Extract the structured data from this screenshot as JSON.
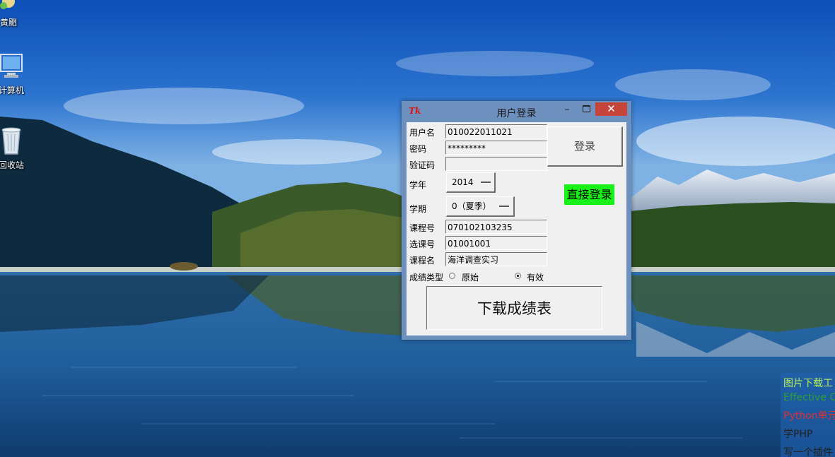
{
  "desktop": {
    "icons": [
      {
        "label": "黄颲",
        "icon": "user-folder-icon"
      },
      {
        "label": "计算机",
        "icon": "computer-icon"
      },
      {
        "label": "回收站",
        "icon": "recycle-bin-icon"
      }
    ]
  },
  "window": {
    "logo": "Tk",
    "title": "用户登录",
    "min_symbol": "–",
    "close_symbol": "✕"
  },
  "form": {
    "username_label": "用户名",
    "username_value": "010022011021",
    "password_label": "密码",
    "password_value": "*********",
    "captcha_label": "验证码",
    "captcha_value": "",
    "login_button": "登录",
    "year_label": "学年",
    "year_value": "2014",
    "term_label": "学期",
    "term_value": "0（夏季）",
    "direct_login_button": "直接登录",
    "course_no_label": "课程号",
    "course_no_value": "070102103235",
    "selection_no_label": "选课号",
    "selection_no_value": "01001001",
    "course_name_label": "课程名",
    "course_name_value": "海洋调查实习",
    "score_type_label": "成绩类型",
    "score_type_options": [
      "原始",
      "有效"
    ],
    "score_type_selected": "有效",
    "download_button": "下载成绩表"
  },
  "side_panel": {
    "items": [
      {
        "text": "图片下载工",
        "color": "#b8f055"
      },
      {
        "text": "Effective C",
        "color": "#2b9e3b"
      },
      {
        "text": "Python单元",
        "color": "#e03030"
      },
      {
        "text": "学PHP",
        "color": "#222222"
      },
      {
        "text": "写一个插件",
        "color": "#222222"
      }
    ]
  }
}
